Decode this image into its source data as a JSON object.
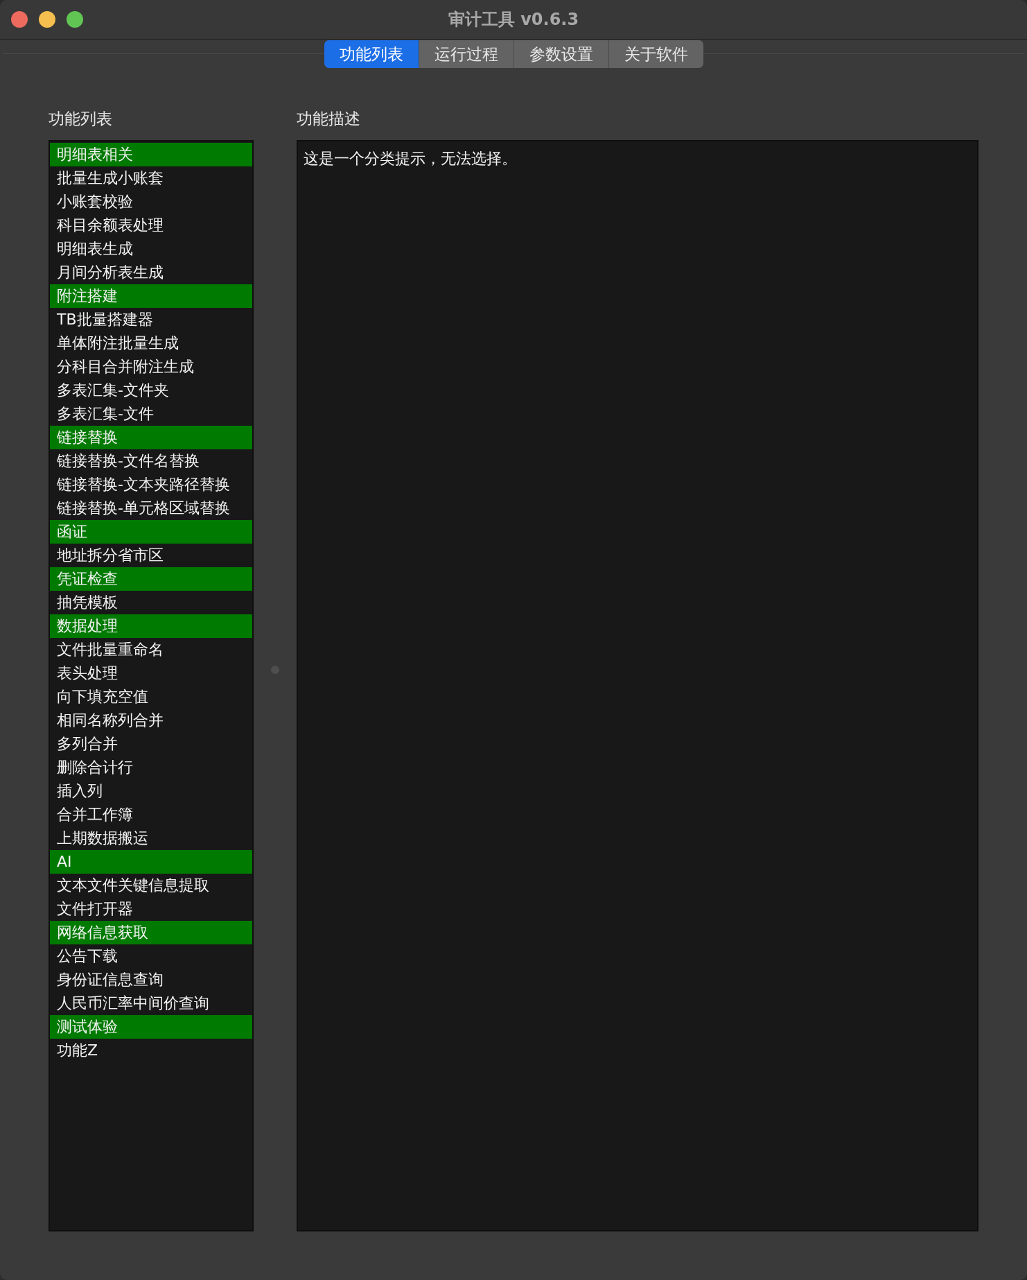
{
  "window": {
    "title": "审计工具 v0.6.3"
  },
  "tabs": [
    {
      "label": "功能列表",
      "selected": true
    },
    {
      "label": "运行过程",
      "selected": false
    },
    {
      "label": "参数设置",
      "selected": false
    },
    {
      "label": "关于软件",
      "selected": false
    }
  ],
  "function_list": {
    "heading": "功能列表",
    "items": [
      {
        "label": "明细表相关",
        "kind": "category"
      },
      {
        "label": "批量生成小账套",
        "kind": "item"
      },
      {
        "label": "小账套校验",
        "kind": "item"
      },
      {
        "label": "科目余额表处理",
        "kind": "item"
      },
      {
        "label": "明细表生成",
        "kind": "item"
      },
      {
        "label": "月间分析表生成",
        "kind": "item"
      },
      {
        "label": "附注搭建",
        "kind": "category"
      },
      {
        "label": "TB批量搭建器",
        "kind": "item"
      },
      {
        "label": "单体附注批量生成",
        "kind": "item"
      },
      {
        "label": "分科目合并附注生成",
        "kind": "item"
      },
      {
        "label": "多表汇集-文件夹",
        "kind": "item"
      },
      {
        "label": "多表汇集-文件",
        "kind": "item"
      },
      {
        "label": "链接替换",
        "kind": "category"
      },
      {
        "label": "链接替换-文件名替换",
        "kind": "item"
      },
      {
        "label": "链接替换-文本夹路径替换",
        "kind": "item"
      },
      {
        "label": "链接替换-单元格区域替换",
        "kind": "item"
      },
      {
        "label": "函证",
        "kind": "category"
      },
      {
        "label": "地址拆分省市区",
        "kind": "item"
      },
      {
        "label": "凭证检查",
        "kind": "category"
      },
      {
        "label": "抽凭模板",
        "kind": "item"
      },
      {
        "label": "数据处理",
        "kind": "category"
      },
      {
        "label": "文件批量重命名",
        "kind": "item"
      },
      {
        "label": "表头处理",
        "kind": "item"
      },
      {
        "label": "向下填充空值",
        "kind": "item"
      },
      {
        "label": "相同名称列合并",
        "kind": "item"
      },
      {
        "label": "多列合并",
        "kind": "item"
      },
      {
        "label": "删除合计行",
        "kind": "item"
      },
      {
        "label": "插入列",
        "kind": "item"
      },
      {
        "label": "合并工作簿",
        "kind": "item"
      },
      {
        "label": "上期数据搬运",
        "kind": "item"
      },
      {
        "label": "AI",
        "kind": "category"
      },
      {
        "label": "文本文件关键信息提取",
        "kind": "item"
      },
      {
        "label": "文件打开器",
        "kind": "item"
      },
      {
        "label": "网络信息获取",
        "kind": "category"
      },
      {
        "label": "公告下载",
        "kind": "item"
      },
      {
        "label": "身份证信息查询",
        "kind": "item"
      },
      {
        "label": "人民币汇率中间价查询",
        "kind": "item"
      },
      {
        "label": "测试体验",
        "kind": "category"
      },
      {
        "label": "功能Z",
        "kind": "item"
      }
    ]
  },
  "description": {
    "heading": "功能描述",
    "text": "这是一个分类提示，无法选择。"
  }
}
